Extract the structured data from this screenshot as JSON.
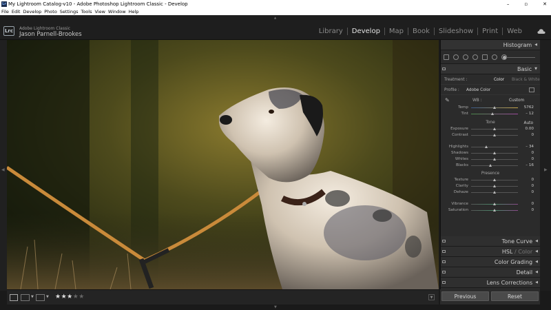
{
  "window": {
    "title": "My Lightroom Catalog-v10 - Adobe Photoshop Lightroom Classic - Develop",
    "app_icon_text": "Lr",
    "controls": [
      "–",
      "▫",
      "✕"
    ]
  },
  "menu": [
    "File",
    "Edit",
    "Develop",
    "Photo",
    "Settings",
    "Tools",
    "View",
    "Window",
    "Help"
  ],
  "identity": {
    "badge": "Lrc",
    "product": "Adobe Lightroom Classic",
    "user": "Jason Parnell-Brookes"
  },
  "modules": [
    "Library",
    "Develop",
    "Map",
    "Book",
    "Slideshow",
    "Print",
    "Web"
  ],
  "active_module": "Develop",
  "panel": {
    "histogram_label": "Histogram",
    "basic_label": "Basic",
    "treatment_label": "Treatment :",
    "treatment_color": "Color",
    "treatment_bw": "Black & White",
    "profile_label": "Profile :",
    "profile_value": "Adobe Color",
    "wb_label": "WB :",
    "wb_value": "Custom",
    "tone_label": "Tone",
    "auto_label": "Auto",
    "presence_label": "Presence",
    "sliders_wb": [
      {
        "label": "Temp",
        "value": "5762",
        "pos": 0.5
      },
      {
        "label": "Tint",
        "value": "– 12",
        "pos": 0.46
      }
    ],
    "sliders_tone": [
      {
        "label": "Exposure",
        "value": "0.00",
        "pos": 0.5
      },
      {
        "label": "Contrast",
        "value": "0",
        "pos": 0.5
      },
      {
        "label": "Highlights",
        "value": "– 34",
        "pos": 0.33
      },
      {
        "label": "Shadows",
        "value": "0",
        "pos": 0.5
      },
      {
        "label": "Whites",
        "value": "0",
        "pos": 0.5
      },
      {
        "label": "Blacks",
        "value": "– 16",
        "pos": 0.42
      }
    ],
    "sliders_presence": [
      {
        "label": "Texture",
        "value": "0",
        "pos": 0.5
      },
      {
        "label": "Clarity",
        "value": "0",
        "pos": 0.5
      },
      {
        "label": "Dehaze",
        "value": "0",
        "pos": 0.5
      },
      {
        "label": "Vibrance",
        "value": "0",
        "pos": 0.5
      },
      {
        "label": "Saturation",
        "value": "0",
        "pos": 0.5
      }
    ],
    "collapsed_sections": [
      "Tone Curve",
      "Color Grading",
      "Detail",
      "Lens Corrections"
    ],
    "hsl_label": "HSL",
    "hsl_sep": " / ",
    "hsl_color": "Color"
  },
  "toolbar": {
    "rating_stars_on": "★★★",
    "rating_stars_off": "★★",
    "rating": 3,
    "rating_max": 5
  },
  "buttons": {
    "previous": "Previous",
    "reset": "Reset"
  },
  "colors": {
    "accent_text": "#e6e6e6",
    "panel_bg": "#2b2b2b",
    "leash": "#c98a3a"
  }
}
